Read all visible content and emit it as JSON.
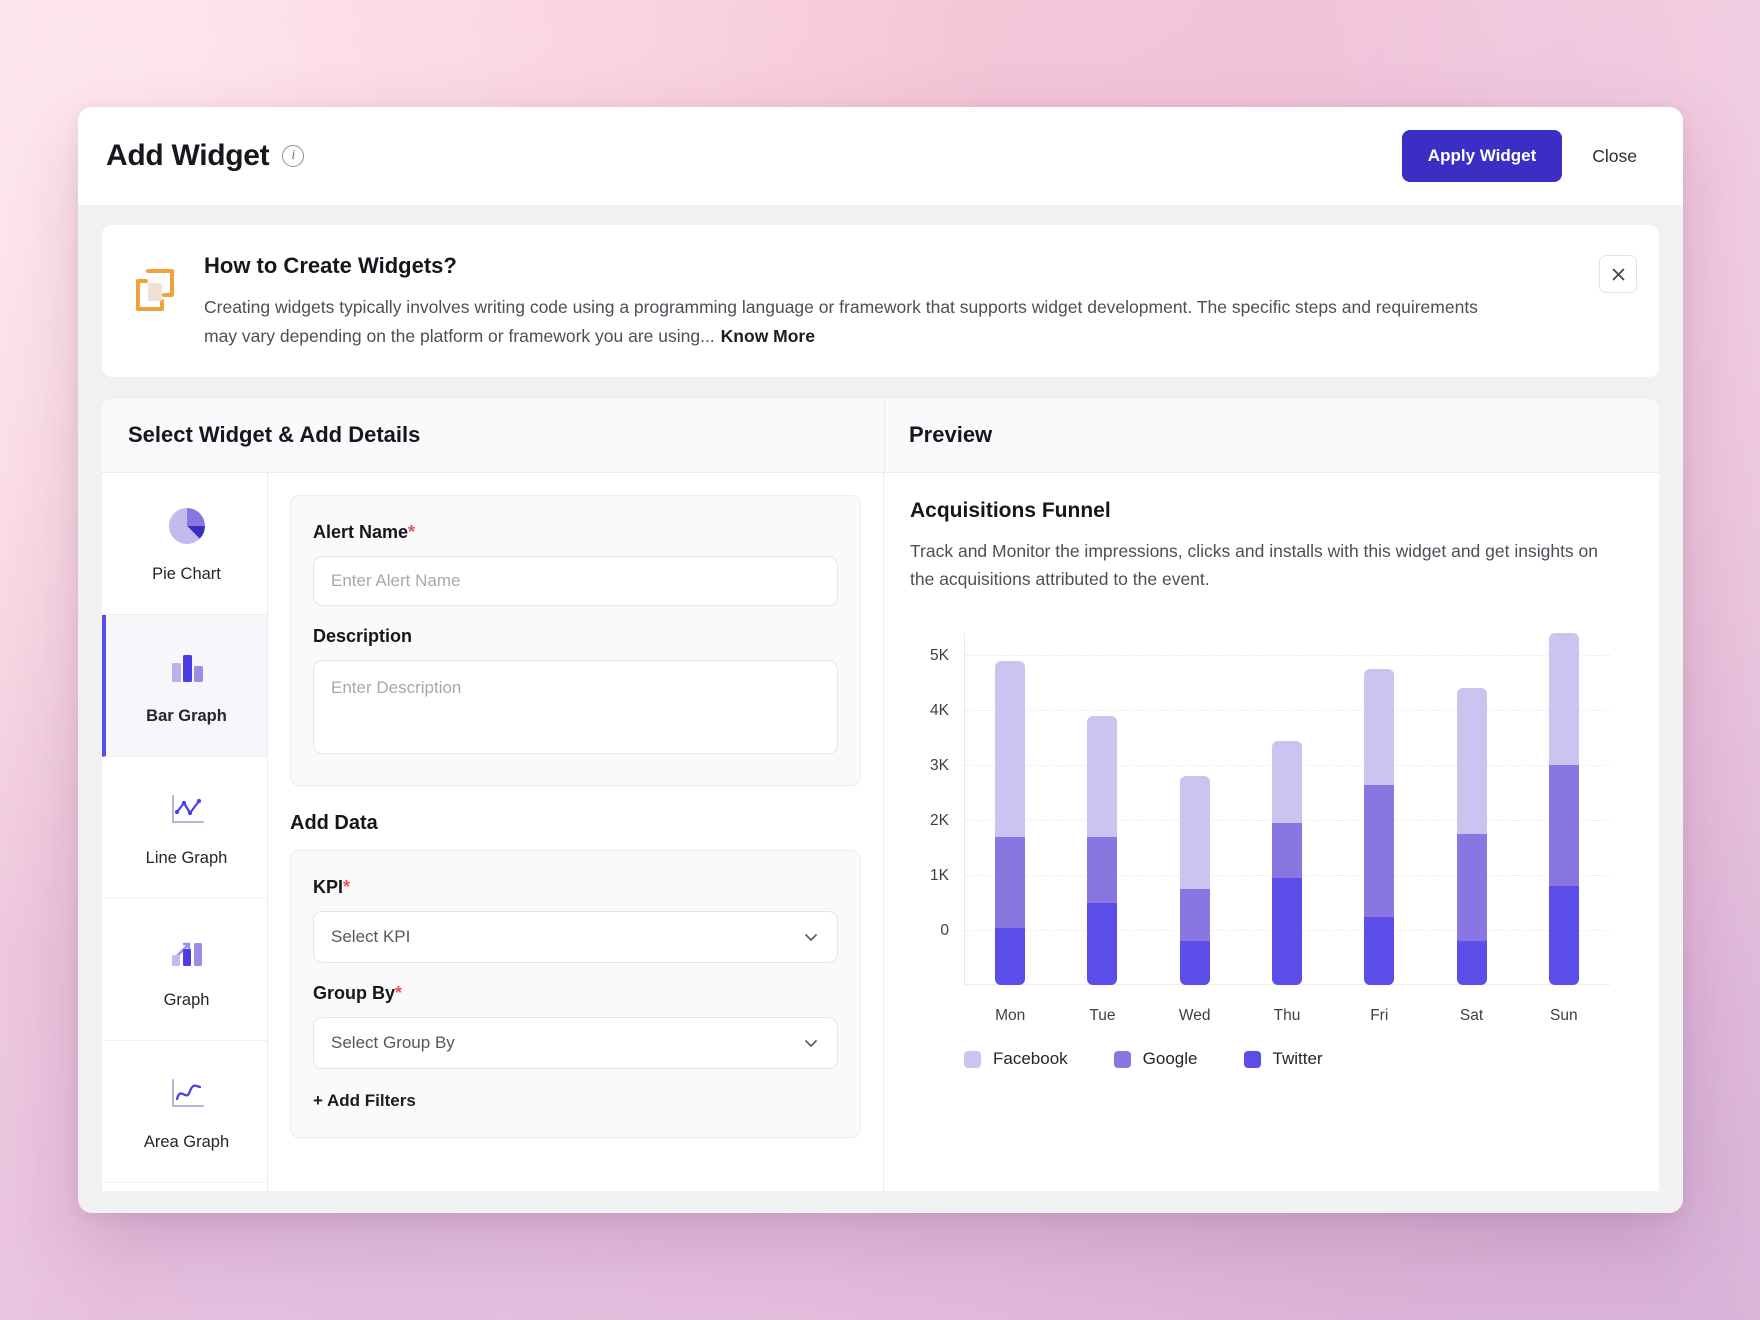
{
  "header": {
    "title": "Add Widget",
    "info_icon": "info-icon",
    "apply_label": "Apply Widget",
    "close_label": "Close"
  },
  "banner": {
    "icon": "widget-frames-icon",
    "title": "How to Create Widgets?",
    "description": "Creating widgets typically involves writing code using a programming language or framework that supports widget development. The specific steps and requirements may vary depending on the platform or framework you are using...",
    "know_more_label": "Know More",
    "close_icon": "close-icon"
  },
  "sections": {
    "left_heading": "Select Widget & Add Details",
    "right_heading": "Preview"
  },
  "widget_types": [
    {
      "label": "Pie Chart",
      "icon": "pie-chart-icon",
      "active": false
    },
    {
      "label": "Bar Graph",
      "icon": "bar-graph-icon",
      "active": true
    },
    {
      "label": "Line Graph",
      "icon": "line-graph-icon",
      "active": false
    },
    {
      "label": "Graph",
      "icon": "growth-graph-icon",
      "active": false
    },
    {
      "label": "Area Graph",
      "icon": "area-graph-icon",
      "active": false
    }
  ],
  "form": {
    "alert_name_label": "Alert Name",
    "alert_name_required": "*",
    "alert_name_value": "",
    "alert_name_placeholder": "Enter Alert Name",
    "description_label": "Description",
    "description_value": "",
    "description_placeholder": "Enter Description",
    "add_data_heading": "Add Data",
    "kpi_label": "KPI",
    "kpi_required": "*",
    "kpi_value": "Select KPI",
    "group_by_label": "Group By",
    "group_by_required": "*",
    "group_by_value": "Select Group By",
    "add_filters_label": "+ Add Filters"
  },
  "preview": {
    "widget_title": "Acquisitions Funnel",
    "widget_description": "Track and Monitor the impressions, clicks and installs with this widget and get insights on the acquisitions attributed to the event."
  },
  "colors": {
    "accent": "#3b2ec4",
    "facebook": "#cbc4f1",
    "google": "#8a76e0",
    "twitter": "#5b4de8",
    "required_star": "#e8505b",
    "banner_icon": "#f0a23c"
  },
  "chart_data": {
    "type": "bar",
    "stacked": true,
    "title": "Acquisitions Funnel",
    "xlabel": "",
    "ylabel": "",
    "categories": [
      "Mon",
      "Tue",
      "Wed",
      "Thu",
      "Fri",
      "Sat",
      "Sun"
    ],
    "yticks": [
      "0",
      "1K",
      "2K",
      "3K",
      "4K",
      "5K"
    ],
    "ylim": [
      -1000,
      5400
    ],
    "grid": true,
    "legend_position": "bottom-left",
    "series": [
      {
        "name": "Twitter",
        "color": "#5b4de8",
        "values": [
          1050,
          1500,
          800,
          1950,
          1250,
          800,
          1800
        ]
      },
      {
        "name": "Google",
        "color": "#8a76e0",
        "values": [
          1650,
          1200,
          950,
          1000,
          2400,
          1950,
          2200
        ]
      },
      {
        "name": "Facebook",
        "color": "#cbc4f1",
        "values": [
          3200,
          2200,
          2050,
          1500,
          2100,
          2650,
          2400
        ]
      }
    ]
  }
}
